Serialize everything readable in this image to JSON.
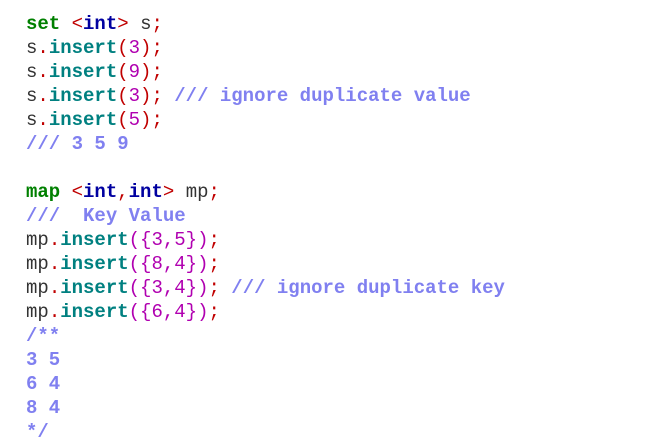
{
  "code": {
    "set_block": {
      "l1": {
        "kw": "set",
        "lt": " <",
        "type": "int",
        "gt": "> ",
        "var": "s",
        "semi": ";"
      },
      "l2": {
        "obj": "s",
        "dot": ".",
        "fn": "insert",
        "open": "(",
        "arg": "3",
        "close": ")",
        "semi": ";"
      },
      "l3": {
        "obj": "s",
        "dot": ".",
        "fn": "insert",
        "open": "(",
        "arg": "9",
        "close": ")",
        "semi": ";"
      },
      "l4": {
        "obj": "s",
        "dot": ".",
        "fn": "insert",
        "open": "(",
        "arg": "3",
        "close": ")",
        "semi": ";",
        "comment": " /// ignore duplicate value"
      },
      "l5": {
        "obj": "s",
        "dot": ".",
        "fn": "insert",
        "open": "(",
        "arg": "5",
        "close": ")",
        "semi": ";"
      },
      "l6": {
        "comment": "/// 3 5 9"
      }
    },
    "map_block": {
      "l1": {
        "kw": "map",
        "lt": " <",
        "type1": "int",
        "comma": ",",
        "type2": "int",
        "gt": "> ",
        "var": "mp",
        "semi": ";"
      },
      "l2": {
        "comment": "///  Key Value"
      },
      "l3": {
        "obj": "mp",
        "dot": ".",
        "fn": "insert",
        "open": "({",
        "a": "3",
        "comma": ",",
        "b": "5",
        "close": "})",
        "semi": ";"
      },
      "l4": {
        "obj": "mp",
        "dot": ".",
        "fn": "insert",
        "open": "({",
        "a": "8",
        "comma": ",",
        "b": "4",
        "close": "})",
        "semi": ";"
      },
      "l5": {
        "obj": "mp",
        "dot": ".",
        "fn": "insert",
        "open": "({",
        "a": "3",
        "comma": ",",
        "b": "4",
        "close": "})",
        "semi": ";",
        "comment": " /// ignore duplicate key"
      },
      "l6": {
        "obj": "mp",
        "dot": ".",
        "fn": "insert",
        "open": "({",
        "a": "6",
        "comma": ",",
        "b": "4",
        "close": "})",
        "semi": ";"
      },
      "c1": "/**",
      "c2": "3 5",
      "c3": "6 4",
      "c4": "8 4",
      "c5": "*/"
    }
  },
  "colors": {
    "keyword": "#008000",
    "type": "#0000a0",
    "function": "#008080",
    "operator": "#c00000",
    "number": "#b000b0",
    "comment": "#8080f0",
    "identifier": "#333333",
    "background": "#ffffff"
  }
}
